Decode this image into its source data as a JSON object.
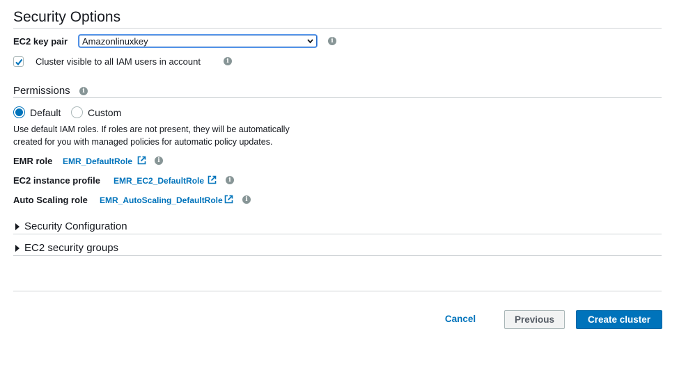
{
  "section": {
    "title": "Security Options"
  },
  "key_pair": {
    "label": "EC2 key pair",
    "selected": "Amazonlinuxkey"
  },
  "visibility": {
    "label": "Cluster visible to all IAM users in account",
    "checked": true
  },
  "permissions": {
    "title": "Permissions",
    "options": [
      {
        "label": "Default",
        "selected": true
      },
      {
        "label": "Custom",
        "selected": false
      }
    ],
    "description_line1": "Use default IAM roles. If roles are not present, they will be automatically",
    "description_line2": "created for you with managed policies for automatic policy updates.",
    "roles": [
      {
        "label": "EMR role",
        "value": "EMR_DefaultRole"
      },
      {
        "label": "EC2 instance profile",
        "value": "EMR_EC2_DefaultRole"
      },
      {
        "label": "Auto Scaling role",
        "value": "EMR_AutoScaling_DefaultRole"
      }
    ]
  },
  "expanders": [
    {
      "label": "Security Configuration"
    },
    {
      "label": "EC2 security groups"
    }
  ],
  "footer": {
    "cancel": "Cancel",
    "previous": "Previous",
    "create": "Create cluster"
  },
  "colors": {
    "accent": "#0073bb",
    "info_icon": "#879596",
    "divider": "#cfd3d6"
  },
  "icons": {
    "info": "info-icon",
    "external": "external-link-icon",
    "checkmark": "checkmark-icon",
    "caret": "caret-right-icon"
  }
}
